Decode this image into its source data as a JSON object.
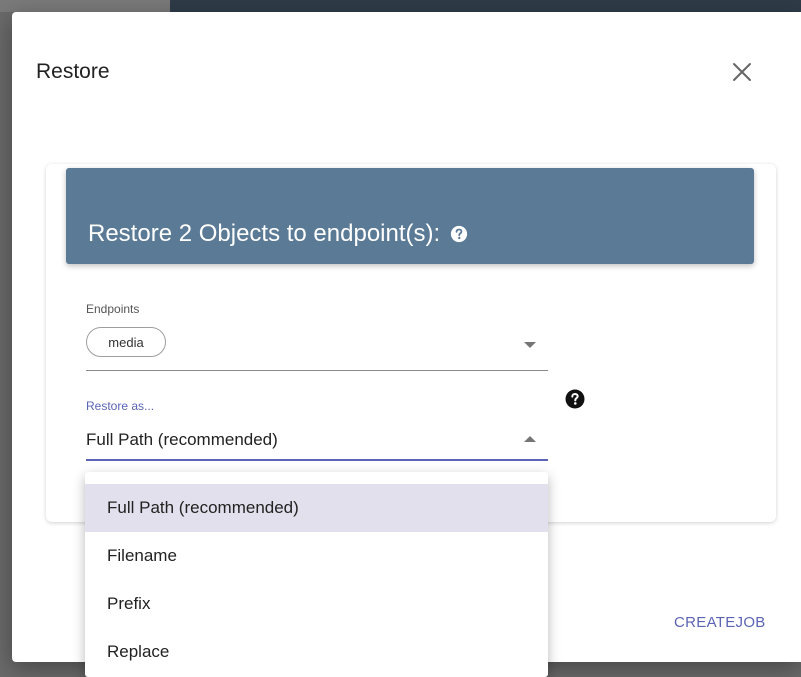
{
  "dialog": {
    "title": "Restore",
    "close_icon": "close-icon"
  },
  "card": {
    "header_title": "Restore 2 Objects to endpoint(s):",
    "header_help_icon": "help-icon"
  },
  "endpoints": {
    "label": "Endpoints",
    "chip": "media"
  },
  "restore_as": {
    "label": "Restore as...",
    "value": "Full Path (recommended)",
    "help_icon": "help-icon"
  },
  "dropdown": {
    "options": [
      "Full Path (recommended)",
      "Filename",
      "Prefix",
      "Replace"
    ],
    "selected": "Full Path (recommended)"
  },
  "actions": {
    "create_job": "CREATEJOB"
  },
  "colors": {
    "header_bg": "#5b7a96",
    "accent": "#5b64b5",
    "selected_option_bg": "#e2e0ec"
  }
}
